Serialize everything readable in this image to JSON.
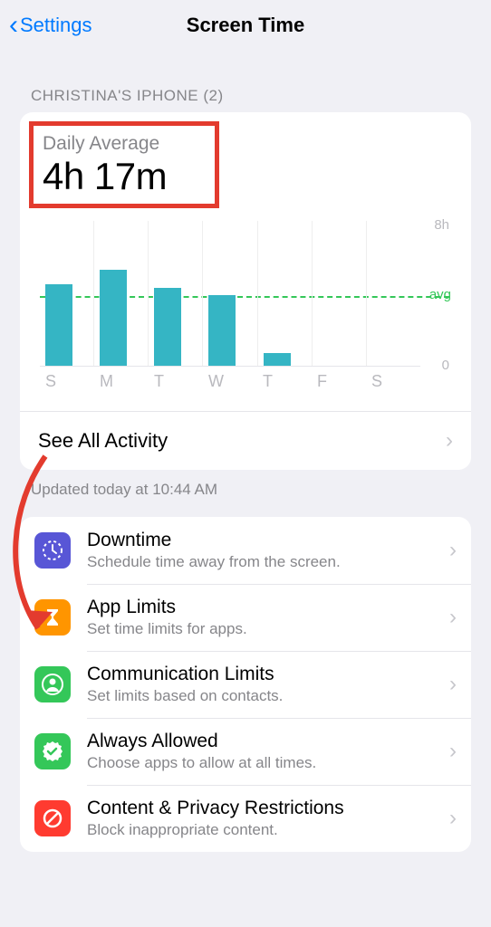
{
  "header": {
    "back_label": "Settings",
    "title": "Screen Time"
  },
  "section_header": "CHRISTINA'S IPHONE (2)",
  "daily_average": {
    "label": "Daily Average",
    "value": "4h 17m"
  },
  "chart_data": {
    "type": "bar",
    "categories": [
      "S",
      "M",
      "T",
      "W",
      "T",
      "F",
      "S"
    ],
    "values": [
      4.5,
      5.3,
      4.3,
      3.9,
      0.7,
      0,
      0
    ],
    "avg": 4.28,
    "ylim": [
      0,
      8
    ],
    "ylabels": {
      "max": "8h",
      "min": "0"
    },
    "avg_label": "avg"
  },
  "see_all_label": "See All Activity",
  "updated_label": "Updated today at 10:44 AM",
  "options": [
    {
      "key": "downtime",
      "title": "Downtime",
      "subtitle": "Schedule time away from the screen.",
      "icon_color": "#5856d6",
      "icon": "downtime"
    },
    {
      "key": "app-limits",
      "title": "App Limits",
      "subtitle": "Set time limits for apps.",
      "icon_color": "#ff9500",
      "icon": "hourglass"
    },
    {
      "key": "communication-limits",
      "title": "Communication Limits",
      "subtitle": "Set limits based on contacts.",
      "icon_color": "#34c759",
      "icon": "person"
    },
    {
      "key": "always-allowed",
      "title": "Always Allowed",
      "subtitle": "Choose apps to allow at all times.",
      "icon_color": "#34c759",
      "icon": "check-badge"
    },
    {
      "key": "content-privacy",
      "title": "Content & Privacy Restrictions",
      "subtitle": "Block inappropriate content.",
      "icon_color": "#ff3b30",
      "icon": "no-sign"
    }
  ],
  "annotation": {
    "highlight_box": "daily_average",
    "arrow_target": "app-limits"
  }
}
